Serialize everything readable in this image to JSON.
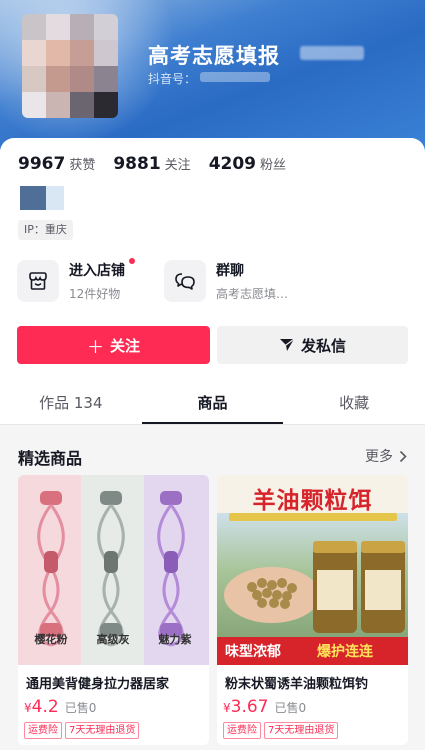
{
  "profile": {
    "nickname": "高考志愿填报",
    "douyin_id_label": "抖音号："
  },
  "stats": [
    {
      "value": "9967",
      "label": "获赞"
    },
    {
      "value": "9881",
      "label": "关注"
    },
    {
      "value": "4209",
      "label": "粉丝"
    }
  ],
  "ip_tag": "IP：重庆",
  "entries": {
    "shop": {
      "title": "进入店铺",
      "subtitle": "12件好物",
      "icon": "store-icon"
    },
    "group": {
      "title": "群聊",
      "subtitle": "高考志愿填…",
      "icon": "chat-bubbles-icon"
    }
  },
  "actions": {
    "follow": "关注",
    "follow_icon": "＋",
    "message": "发私信"
  },
  "tabs": [
    {
      "label": "作品 134",
      "active": false
    },
    {
      "label": "商品",
      "active": true
    },
    {
      "label": "收藏",
      "active": false
    }
  ],
  "shop_section": {
    "title": "精选商品",
    "more": "更多"
  },
  "products": [
    {
      "name": "通用美背健身拉力器居家",
      "currency": "¥",
      "price": "4.2",
      "sold": "已售0",
      "tags": [
        "运费险",
        "7天无理由退货"
      ],
      "band_labels": [
        "樱花粉",
        "高级灰",
        "魅力紫"
      ]
    },
    {
      "name": "粉末状蜀诱羊油颗粒饵钓",
      "currency": "¥",
      "price": "3.67",
      "sold": "已售0",
      "tags": [
        "运费险",
        "7天无理由退货"
      ],
      "banner_title": "羊油颗粒饵",
      "banner_left": "味型浓郁",
      "banner_right": "爆护连连"
    }
  ],
  "colors": {
    "accent": "#fe2c55",
    "header_blue": "#2a6bc4"
  }
}
